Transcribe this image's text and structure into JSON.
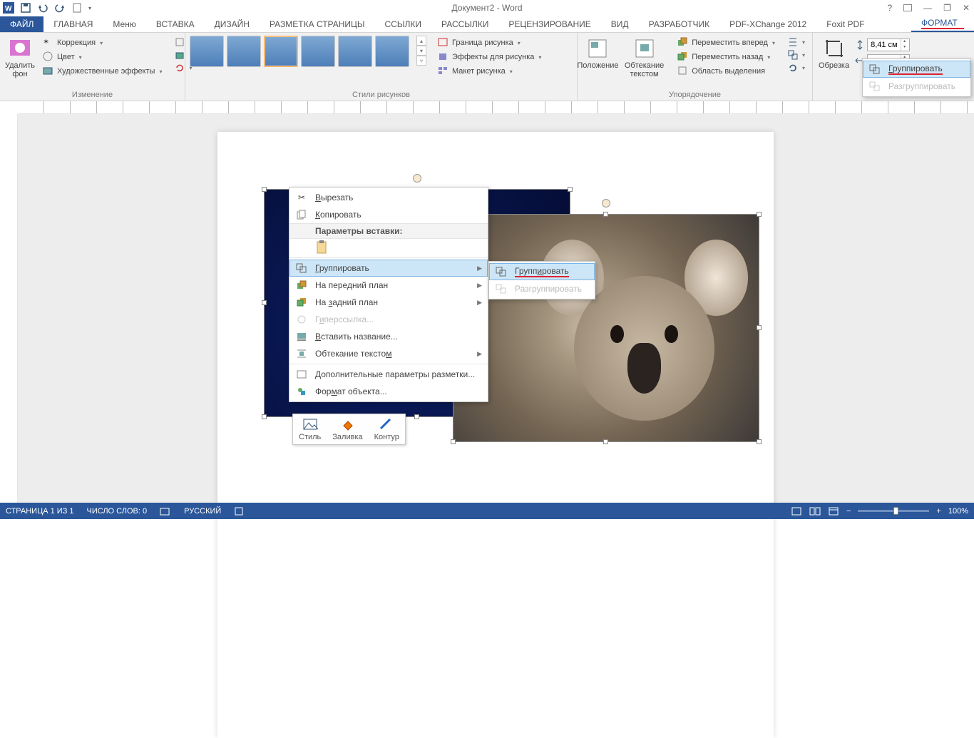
{
  "app": {
    "title": "Документ2 - Word"
  },
  "tabs": {
    "file": "ФАЙЛ",
    "items": [
      "ГЛАВНАЯ",
      "Меню",
      "ВСТАВКА",
      "ДИЗАЙН",
      "РАЗМЕТКА СТРАНИЦЫ",
      "ССЫЛКИ",
      "РАССЫЛКИ",
      "РЕЦЕНЗИРОВАНИЕ",
      "ВИД",
      "РАЗРАБОТЧИК",
      "PDF-XChange 2012",
      "Foxit PDF"
    ],
    "active": "ФОРМАТ"
  },
  "ribbon": {
    "adjust": {
      "label": "Изменение",
      "remove_bg": "Удалить\nфон",
      "corrections": "Коррекция",
      "color": "Цвет",
      "artistic": "Художественные эффекты"
    },
    "styles": {
      "label": "Стили рисунков",
      "border": "Граница рисунка",
      "effects": "Эффекты для рисунка",
      "layout": "Макет рисунка"
    },
    "arrange": {
      "label": "Упорядочение",
      "position": "Положение",
      "wrap": "Обтекание\nтекстом",
      "forward": "Переместить вперед",
      "backward": "Переместить назад",
      "selection": "Область выделения"
    },
    "size": {
      "crop": "Обрезка",
      "height": "8,41 см"
    },
    "dropdown": {
      "group": "Группировать",
      "ungroup": "Разгруппировать"
    }
  },
  "context": {
    "cut": "Вырезать",
    "copy": "Копировать",
    "paste_header": "Параметры вставки:",
    "group": "Группировать",
    "front": "На передний план",
    "back": "На задний план",
    "hyperlink": "Гиперссылка...",
    "caption": "Вставить название...",
    "wrap": "Обтекание текстом",
    "more_layout": "Дополнительные параметры разметки...",
    "format_obj": "Формат объекта..."
  },
  "submenu": {
    "group": "Группировать",
    "ungroup": "Разгруппировать"
  },
  "mini": {
    "style": "Стиль",
    "fill": "Заливка",
    "outline": "Контур"
  },
  "status": {
    "page": "СТРАНИЦА 1 ИЗ 1",
    "words": "ЧИСЛО СЛОВ: 0",
    "lang": "РУССКИЙ",
    "zoom": "100%"
  }
}
